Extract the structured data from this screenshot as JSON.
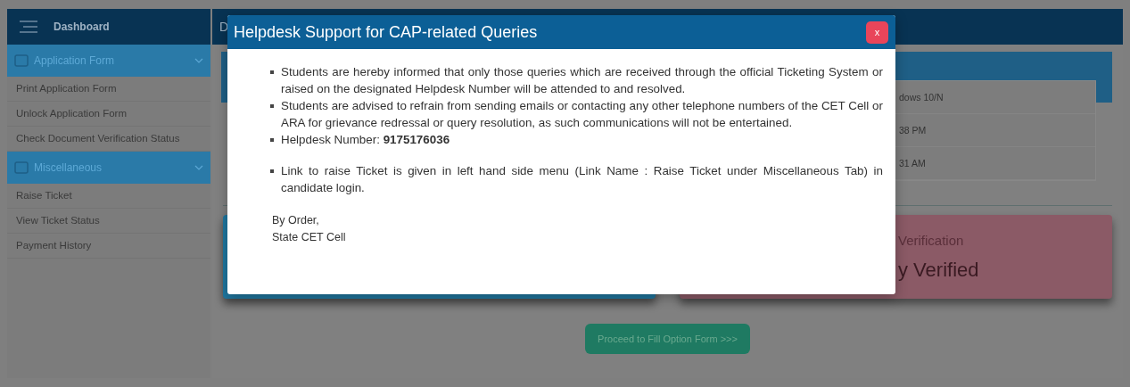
{
  "sidebar": {
    "title": "Dashboard",
    "sections": [
      {
        "title": "Application Form",
        "expanded": true,
        "items": [
          "Print Application Form",
          "Unlock Application Form",
          "Check Document Verification Status"
        ]
      },
      {
        "title": "Miscellaneous",
        "expanded": true,
        "items": [
          "Raise Ticket",
          "View Ticket Status",
          "Payment History"
        ]
      }
    ]
  },
  "main": {
    "header_title": "D",
    "info_rows": [
      "dows 10/N",
      "38 PM",
      "31 AM"
    ],
    "cards": [
      {
        "kind": "blue"
      },
      {
        "kind": "pink",
        "label": "Verification",
        "value": "y Verified"
      }
    ],
    "proceed_button": "Proceed to Fill Option Form >>>"
  },
  "modal": {
    "title": "Helpdesk Support for CAP-related Queries",
    "close": "x",
    "bullets": [
      "Students are hereby informed that only those queries which are received through the official Ticketing System or raised on the designated Helpdesk Number will be attended to and resolved.",
      "Students are advised to refrain from sending emails or contacting any other telephone numbers of the CET Cell or ARA for grievance redressal or query resolution, as such communications will not be entertained.",
      "Helpdesk Number: **9175176036**",
      "Link to raise Ticket is given in left hand side menu (Link Name : Raise Ticket under Miscellaneous Tab) in candidate login."
    ],
    "signoff": [
      "By Order,",
      "State CET Cell"
    ]
  }
}
